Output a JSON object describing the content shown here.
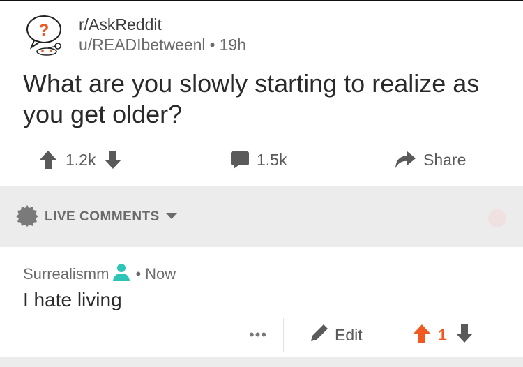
{
  "post": {
    "subreddit": "r/AskReddit",
    "author": "u/READIbetweenl",
    "separator": "•",
    "age": "19h",
    "title": "What are you slowly starting to realize as you get older?",
    "upvotes": "1.2k",
    "comments": "1.5k",
    "share_label": "Share"
  },
  "live_comments": {
    "label": "LIVE COMMENTS"
  },
  "comment": {
    "author": "Surrealismm",
    "separator": "•",
    "age": "Now",
    "body": "I hate living",
    "more_label": "•••",
    "edit_label": "Edit",
    "score": "1"
  },
  "icons": {
    "subreddit_avatar": "askreddit-snoo-icon",
    "upvote": "upvote-arrow-icon",
    "downvote": "downvote-arrow-icon",
    "comments": "speech-bubble-icon",
    "share": "share-arrow-icon",
    "live": "gear-badge-icon",
    "dropdown": "caret-down-icon",
    "op_badge": "user-person-icon",
    "edit": "pencil-icon"
  },
  "colors": {
    "upvote_active": "#f05a22",
    "op_badge": "#2ec4b6",
    "band_gray": "#ececec",
    "icon_gray": "#5a5a5a"
  }
}
